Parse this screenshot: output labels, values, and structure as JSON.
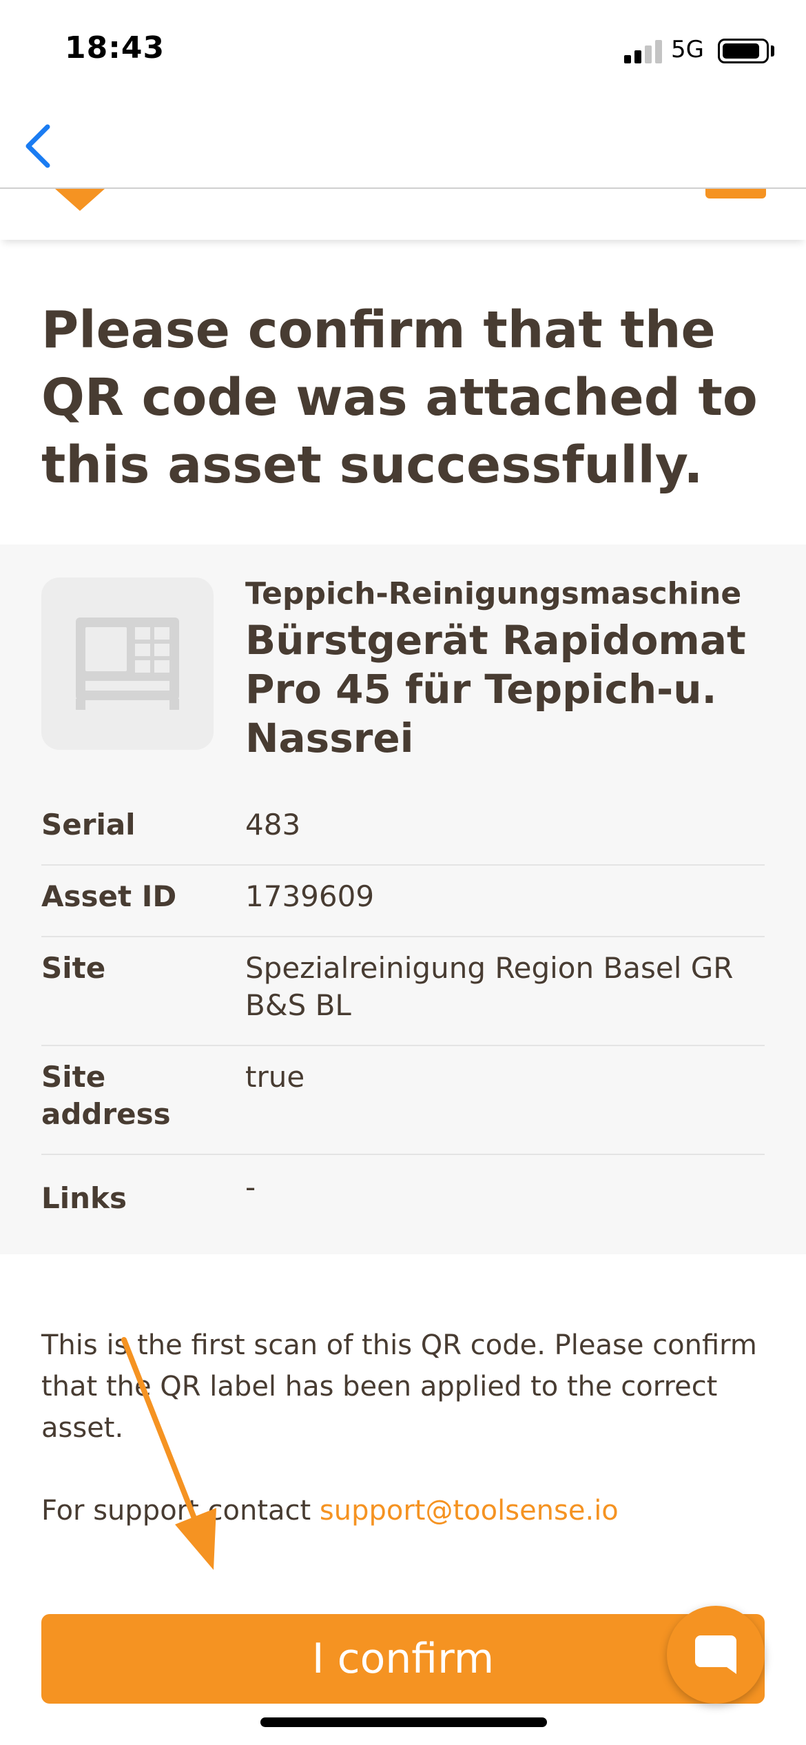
{
  "status_bar": {
    "time": "18:43",
    "network": "5G",
    "battery_level": 0.85,
    "signal_bars_active": 2
  },
  "nav": {
    "back_icon": "chevron-left-icon"
  },
  "headline": "Please confirm that the QR code was attached to this asset successfully.",
  "asset": {
    "category": "Teppich-Reinigungsmaschine",
    "name": "Bürstgerät Rapidomat Pro 45 für Teppich-u. Nassrei",
    "thumbnail_icon": "machine-placeholder-icon",
    "details": [
      {
        "label": "Serial",
        "value": "483"
      },
      {
        "label": "Asset ID",
        "value": "1739609"
      },
      {
        "label": "Site",
        "value": "Spezialreinigung Region Basel GR B&S BL"
      },
      {
        "label": "Site address",
        "value": "true"
      },
      {
        "label": "Links",
        "value": "-"
      }
    ]
  },
  "info": {
    "message": "This is the first scan of this QR code. Please confirm that the QR label has been applied to the correct asset.",
    "support_prefix": "For support contact ",
    "support_email": "support@toolsense.io"
  },
  "confirm_button_label": "I confirm",
  "colors": {
    "accent": "#f59322",
    "text": "#483c32",
    "card_bg": "#f7f7f7",
    "back_blue": "#1a7cf2"
  }
}
